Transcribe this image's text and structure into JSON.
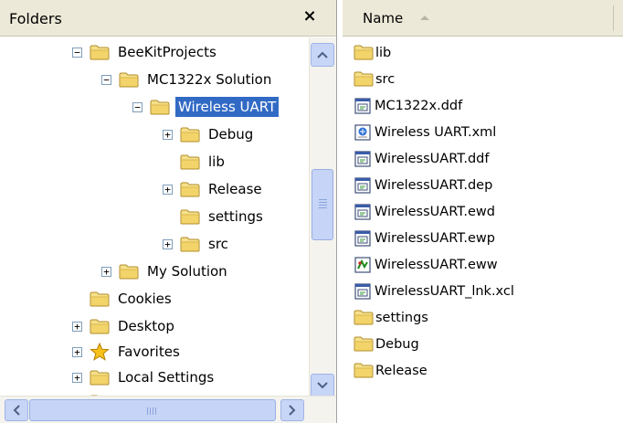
{
  "left_pane": {
    "title": "Folders",
    "close_glyph": "×",
    "tree": [
      {
        "label": "BeeKitProjects",
        "toggle": "−"
      },
      {
        "label": "MC1322x Solution",
        "toggle": "−"
      },
      {
        "label": "Wireless UART",
        "toggle": "−",
        "selected": true
      },
      {
        "label": "Debug",
        "toggle": "+"
      },
      {
        "label": "lib",
        "toggle": ""
      },
      {
        "label": "Release",
        "toggle": "+"
      },
      {
        "label": "settings",
        "toggle": ""
      },
      {
        "label": "src",
        "toggle": "+"
      },
      {
        "label": "My Solution",
        "toggle": "+"
      },
      {
        "label": "Cookies",
        "toggle": ""
      },
      {
        "label": "Desktop",
        "toggle": "+"
      },
      {
        "label": "Favorites",
        "toggle": "+",
        "icon": "star-icon"
      },
      {
        "label": "Local Settings",
        "toggle": "+"
      }
    ]
  },
  "right_pane": {
    "column_name": "Name",
    "files": [
      {
        "name": "lib",
        "icon": "folder-icon"
      },
      {
        "name": "src",
        "icon": "folder-icon"
      },
      {
        "name": "MC1322x.ddf",
        "icon": "ddf-file-icon"
      },
      {
        "name": "Wireless UART.xml",
        "icon": "xml-file-icon"
      },
      {
        "name": "WirelessUART.ddf",
        "icon": "ddf-file-icon"
      },
      {
        "name": "WirelessUART.dep",
        "icon": "dep-file-icon"
      },
      {
        "name": "WirelessUART.ewd",
        "icon": "ewd-file-icon"
      },
      {
        "name": "WirelessUART.ewp",
        "icon": "ewp-file-icon"
      },
      {
        "name": "WirelessUART.eww",
        "icon": "eww-file-icon"
      },
      {
        "name": "WirelessUART_lnk.xcl",
        "icon": "xcl-file-icon"
      },
      {
        "name": "settings",
        "icon": "folder-icon"
      },
      {
        "name": "Debug",
        "icon": "folder-icon"
      },
      {
        "name": "Release",
        "icon": "folder-icon"
      }
    ]
  },
  "colors": {
    "selection": "#316ac5",
    "header": "#ece9d8",
    "folder": "#f2d36b",
    "scrollbar": "#c7d5f7"
  }
}
